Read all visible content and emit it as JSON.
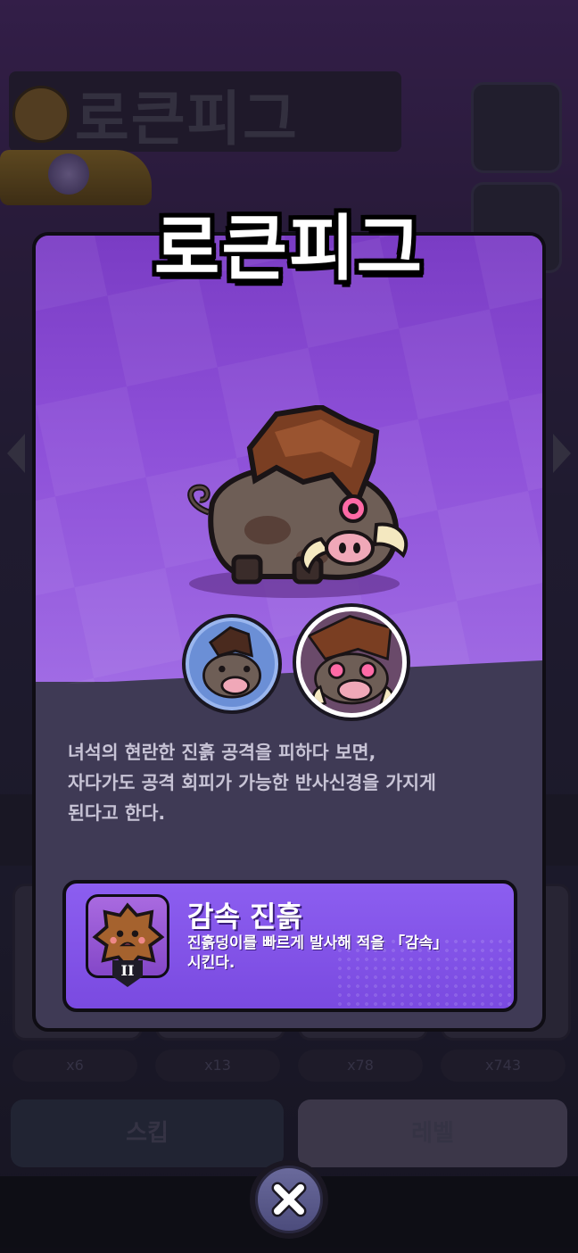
{
  "background": {
    "title": "로큰피그",
    "slot_counts": [
      "x6",
      "x13",
      "x78",
      "x743"
    ],
    "buttons": [
      "스킵",
      "레벨"
    ]
  },
  "modal": {
    "title": "로큰피그",
    "description": "녀석의 현란한 진흙 공격을 피하다 보면,\n자다가도 공격 회피가 가능한 반사신경을 가지게\n된다고 한다.",
    "skill": {
      "name": "감속 진흙",
      "description": "진흙덩이를 빠르게 발사해 적을 「감속」\n시킨다.",
      "tier": "II",
      "icon": "mud-splat-icon"
    },
    "portraits": [
      "boar-form-1",
      "boar-form-2"
    ],
    "close_icon": "close-icon"
  },
  "colors": {
    "hero_purple": "#8d4fd8",
    "panel": "#3f3a55",
    "skill_card": "#8c5ef0"
  }
}
